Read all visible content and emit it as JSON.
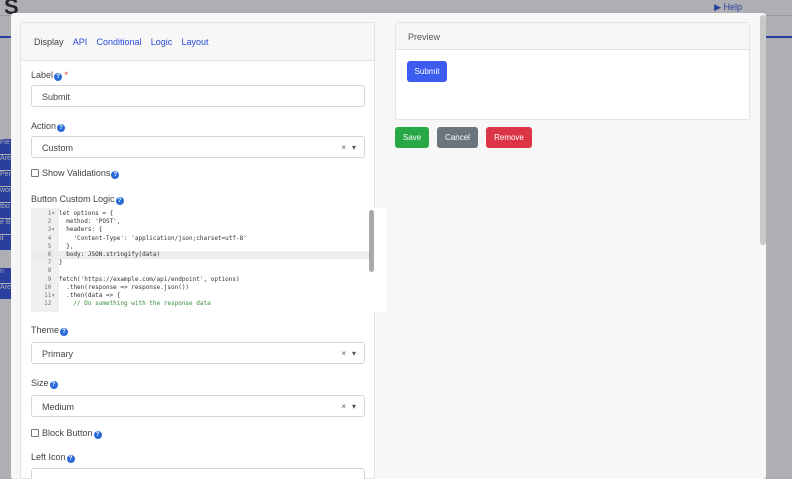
{
  "background": {
    "help_label": "Help",
    "sidebar_fragments": [
      "Fie",
      "Are",
      "Per",
      "wor",
      "tbo",
      "e B",
      "it",
      "",
      "n",
      "Are"
    ]
  },
  "tabs": [
    {
      "label": "Display",
      "active": true
    },
    {
      "label": "API",
      "active": false
    },
    {
      "label": "Conditional",
      "active": false
    },
    {
      "label": "Logic",
      "active": false
    },
    {
      "label": "Layout",
      "active": false
    }
  ],
  "form": {
    "label_field": {
      "label": "Label",
      "required_mark": "*",
      "value": "Submit"
    },
    "action_field": {
      "label": "Action",
      "value": "Custom"
    },
    "show_validations": {
      "label": "Show Validations",
      "checked": false
    },
    "custom_logic": {
      "label": "Button Custom Logic",
      "lines": [
        {
          "num": "1",
          "fold": true,
          "text": "let options = {"
        },
        {
          "num": "2",
          "fold": false,
          "text": "  method: 'POST',"
        },
        {
          "num": "3",
          "fold": true,
          "text": "  headers: {"
        },
        {
          "num": "4",
          "fold": false,
          "text": "    'Content-Type': 'application/json;charset=utf-8'"
        },
        {
          "num": "5",
          "fold": false,
          "text": "  },"
        },
        {
          "num": "6",
          "fold": false,
          "text": "  body: JSON.stringify(data)"
        },
        {
          "num": "7",
          "fold": false,
          "text": "}"
        },
        {
          "num": "8",
          "fold": false,
          "text": ""
        },
        {
          "num": "9",
          "fold": false,
          "text": "fetch('https://example.com/api/endpoint', options)"
        },
        {
          "num": "10",
          "fold": false,
          "text": "  .then(response => response.json())"
        },
        {
          "num": "11",
          "fold": true,
          "text": "  .then(data => {"
        },
        {
          "num": "12",
          "fold": false,
          "text": "    // Do something with the response data"
        }
      ]
    },
    "theme_field": {
      "label": "Theme",
      "value": "Primary"
    },
    "size_field": {
      "label": "Size",
      "value": "Medium"
    },
    "block_button": {
      "label": "Block Button",
      "checked": false
    },
    "left_icon_field": {
      "label": "Left Icon"
    },
    "clear_symbol": "×",
    "dropdown_symbol": "▾",
    "help_symbol": "?"
  },
  "preview": {
    "title": "Preview",
    "button_label": "Submit"
  },
  "actions": {
    "save": "Save",
    "cancel": "Cancel",
    "remove": "Remove"
  },
  "colors": {
    "primary": "#3c5cf0",
    "save": "#27a844",
    "cancel": "#6b757d",
    "remove": "#dc3545",
    "link": "#2a4ad8"
  }
}
